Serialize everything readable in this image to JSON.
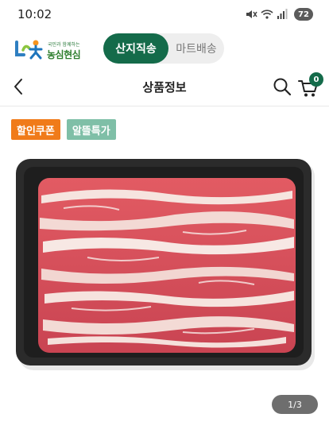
{
  "status": {
    "time": "10:02",
    "battery": "72",
    "icons": [
      "mute-icon",
      "wifi-icon",
      "signal-icon",
      "battery-icon"
    ]
  },
  "header": {
    "logo": {
      "tagline": "국민과 함께하는",
      "name": "농심현심"
    },
    "channels": [
      {
        "label": "산지직송",
        "active": true
      },
      {
        "label": "마트배송",
        "active": false
      }
    ]
  },
  "titlebar": {
    "title": "상품정보",
    "cart_count": "0"
  },
  "product": {
    "badges": [
      "할인쿠폰",
      "알뜰특가"
    ],
    "page_indicator": "1/3"
  },
  "colors": {
    "brand_green": "#146b4a",
    "coupon_orange": "#f07b1a",
    "special_mint": "#7fbfa7"
  }
}
